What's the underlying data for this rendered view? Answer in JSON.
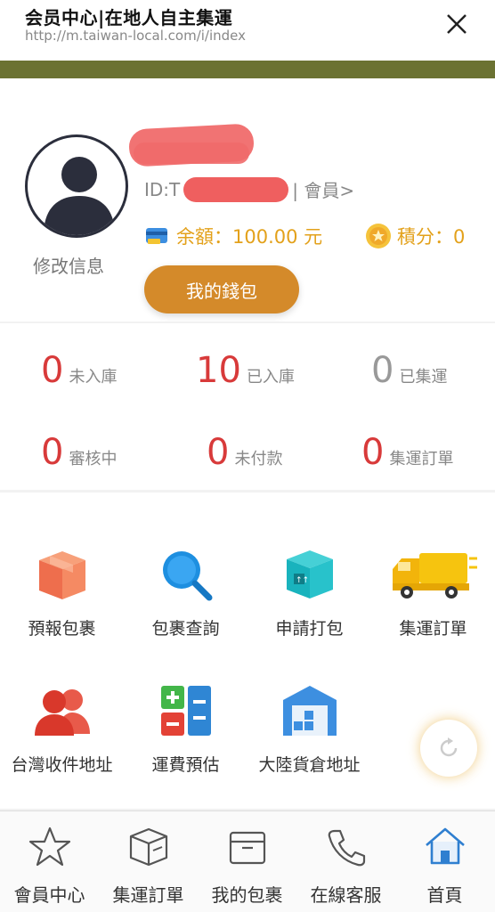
{
  "browser": {
    "title": "会员中心|在地人自主集運",
    "url": "http://m.taiwan-local.com/i/index"
  },
  "profile": {
    "edit_label": "修改信息",
    "id_prefix": "ID:T",
    "member_link": "| 會員>",
    "balance_label": "余額：100.00 元",
    "points_label": "積分：0",
    "wallet_button": "我的錢包"
  },
  "stats": [
    {
      "value": "0",
      "label": "未入庫"
    },
    {
      "value": "10",
      "label": "已入庫"
    },
    {
      "value": "0",
      "label": "已集運"
    },
    {
      "value": "0",
      "label": "審核中"
    },
    {
      "value": "0",
      "label": "未付款"
    },
    {
      "value": "0",
      "label": "集運訂單"
    }
  ],
  "services": [
    {
      "label": "預報包裹",
      "icon": "package-icon"
    },
    {
      "label": "包裹查詢",
      "icon": "search-icon"
    },
    {
      "label": "申請打包",
      "icon": "box-icon"
    },
    {
      "label": "集運訂單",
      "icon": "truck-icon"
    },
    {
      "label": "台灣收件地址",
      "icon": "users-icon"
    },
    {
      "label": "運費預估",
      "icon": "calculator-icon"
    },
    {
      "label": "大陸貨倉地址",
      "icon": "warehouse-icon"
    }
  ],
  "bottom_nav": [
    {
      "label": "會員中心",
      "icon": "star-icon"
    },
    {
      "label": "集運訂單",
      "icon": "cube-icon"
    },
    {
      "label": "我的包裹",
      "icon": "parcel-icon"
    },
    {
      "label": "在線客服",
      "icon": "phone-icon"
    },
    {
      "label": "首頁",
      "icon": "home-icon"
    }
  ],
  "colors": {
    "accent_red": "#d83a3a",
    "wallet_orange": "#d48a2a",
    "gold": "#e3a11b",
    "header_olive": "#6b7232"
  }
}
